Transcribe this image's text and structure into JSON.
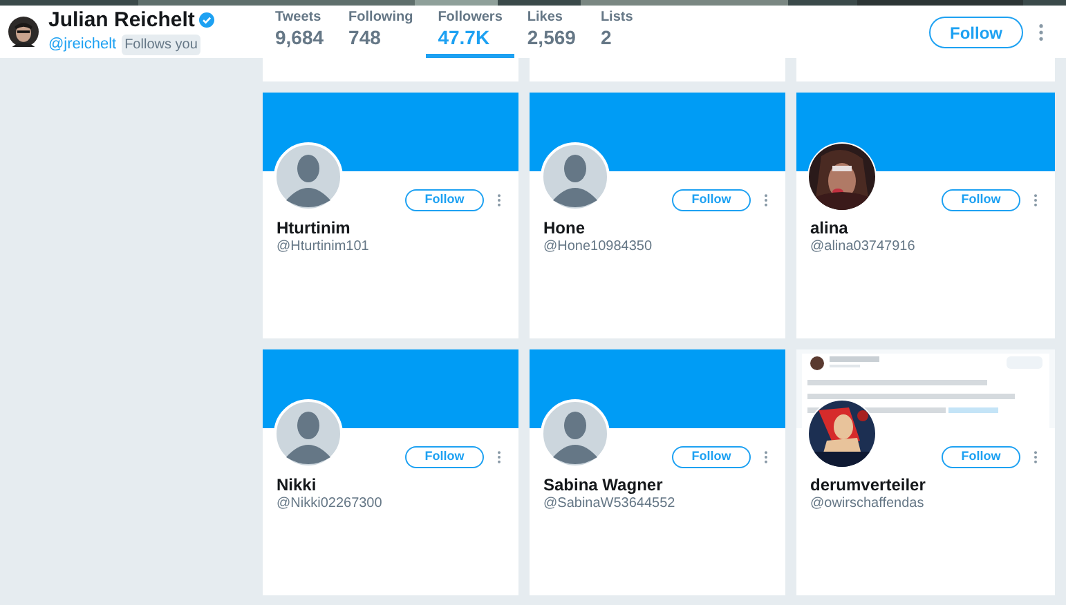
{
  "profile": {
    "name": "Julian Reichelt",
    "verified": true,
    "handle": "@jreichelt",
    "badge": "Follows you"
  },
  "stats": [
    {
      "label": "Tweets",
      "value": "9,684",
      "selected": false
    },
    {
      "label": "Following",
      "value": "748",
      "selected": false
    },
    {
      "label": "Followers",
      "value": "47.7K",
      "selected": true
    },
    {
      "label": "Likes",
      "value": "2,569",
      "selected": false
    },
    {
      "label": "Lists",
      "value": "2",
      "selected": false
    }
  ],
  "header_button": "Follow",
  "cards": [
    {
      "name": "Hturtinim",
      "handle": "@Hturtinim101",
      "avatar": {
        "kind": "default"
      },
      "banner": {
        "kind": "plain"
      },
      "button": "Follow"
    },
    {
      "name": "Hone",
      "handle": "@Hone10984350",
      "avatar": {
        "kind": "default"
      },
      "banner": {
        "kind": "plain"
      },
      "button": "Follow"
    },
    {
      "name": "alina",
      "handle": "@alina03747916",
      "banner": {
        "kind": "plain"
      },
      "button": "Follow"
    },
    {
      "name": "Nikki",
      "handle": "@Nikki02267300",
      "avatar": {
        "kind": "default"
      },
      "banner": {
        "kind": "plain"
      },
      "button": "Follow"
    },
    {
      "name": "Sabina Wagner",
      "handle": "@SabinaW53644552",
      "avatar": {
        "kind": "default"
      },
      "banner": {
        "kind": "plain"
      },
      "button": "Follow"
    },
    {
      "name": "derumverteiler",
      "handle": "@owirschaffendas",
      "button": "Follow"
    }
  ]
}
